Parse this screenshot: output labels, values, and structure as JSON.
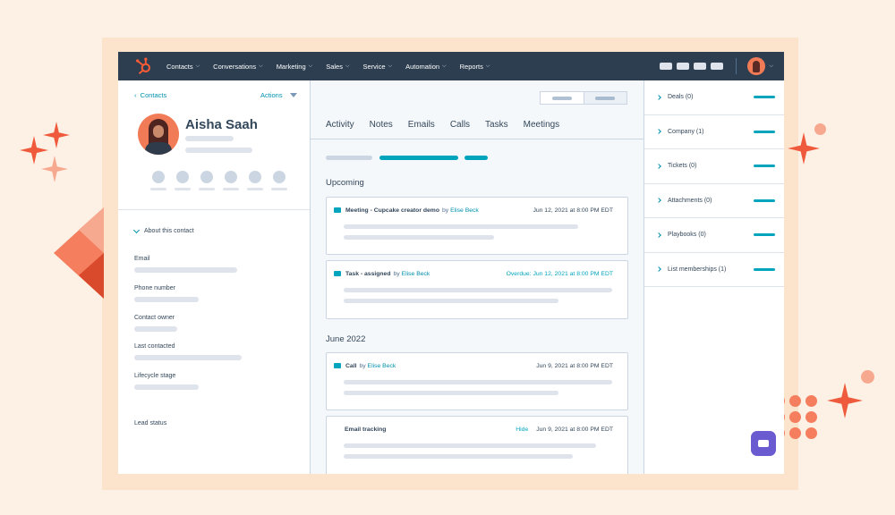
{
  "nav": {
    "items": [
      {
        "label": "Contacts"
      },
      {
        "label": "Conversations"
      },
      {
        "label": "Marketing"
      },
      {
        "label": "Sales"
      },
      {
        "label": "Service"
      },
      {
        "label": "Automation"
      },
      {
        "label": "Reports"
      }
    ]
  },
  "contact": {
    "back_label": "Contacts",
    "actions_label": "Actions",
    "name": "Aisha Saah",
    "about_label": "About this contact",
    "properties": [
      "Email",
      "Phone number",
      "Contact owner",
      "Last contacted",
      "Lifecycle stage",
      "Lead status"
    ]
  },
  "timeline": {
    "tabs": [
      "Activity",
      "Notes",
      "Emails",
      "Calls",
      "Tasks",
      "Meetings"
    ],
    "sections": {
      "upcoming": "Upcoming",
      "june": "June 2022"
    },
    "cards": [
      {
        "title": "Meeting - Cupcake creator demo",
        "by": "by",
        "author": "Elise Beck",
        "date": "Jun 12, 2021 at 8:00 PM EDT"
      },
      {
        "title": "Task - assigned",
        "by": "by",
        "author": "Elise Beck",
        "date": "Overdue: Jun 12, 2021 at 8:00 PM EDT"
      },
      {
        "title": "Call",
        "by": "by",
        "author": "Elise Beck",
        "date": "Jun 9, 2021 at 8:00 PM EDT"
      },
      {
        "title": "Email tracking",
        "hide": "Hide",
        "date": "Jun 9, 2021 at 8:00 PM EDT"
      }
    ]
  },
  "associations": [
    {
      "label": "Deals (0)"
    },
    {
      "label": "Company (1)"
    },
    {
      "label": "Tickets (0)"
    },
    {
      "label": "Attachments (0)"
    },
    {
      "label": "Playbooks (0)"
    },
    {
      "label": "List memberships (1)"
    }
  ],
  "colors": {
    "nav_bg": "#2d3e50",
    "accent_teal": "#00a4bd",
    "link": "#0091ae",
    "brand_orange": "#ff5c35",
    "chat_purple": "#6a5bd1"
  }
}
